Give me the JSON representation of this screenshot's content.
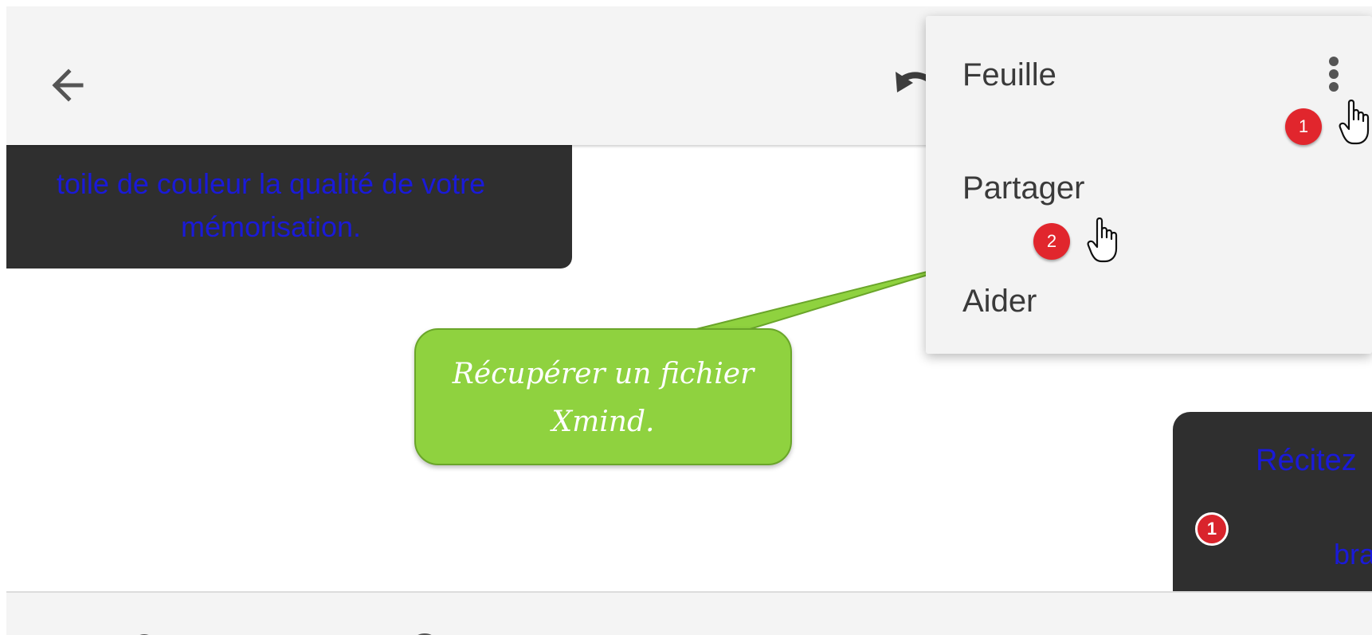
{
  "menu": {
    "items": [
      "Feuille",
      "Partager",
      "Aider"
    ]
  },
  "nodes": {
    "left_line1": "toile de couleur la qualité de votre",
    "left_line2": "mémorisation.",
    "right_title": "Récitez",
    "right_fragment": "bra",
    "right_badge": "1"
  },
  "callout": {
    "line1": "Récupérer un fichier",
    "line2": "Xmind."
  },
  "steps": [
    "1",
    "2"
  ],
  "icons": {
    "back": "arrow-left-icon",
    "undo": "undo-icon",
    "overflow": "more-vertical-icon",
    "cursor": "hand-pointer-icon"
  },
  "colors": {
    "node_bg": "#2f2f2f",
    "node_text": "#1a1ad8",
    "callout_bg": "#8fd23f",
    "badge": "#e1262d",
    "bar_bg": "#f4f4f4"
  }
}
